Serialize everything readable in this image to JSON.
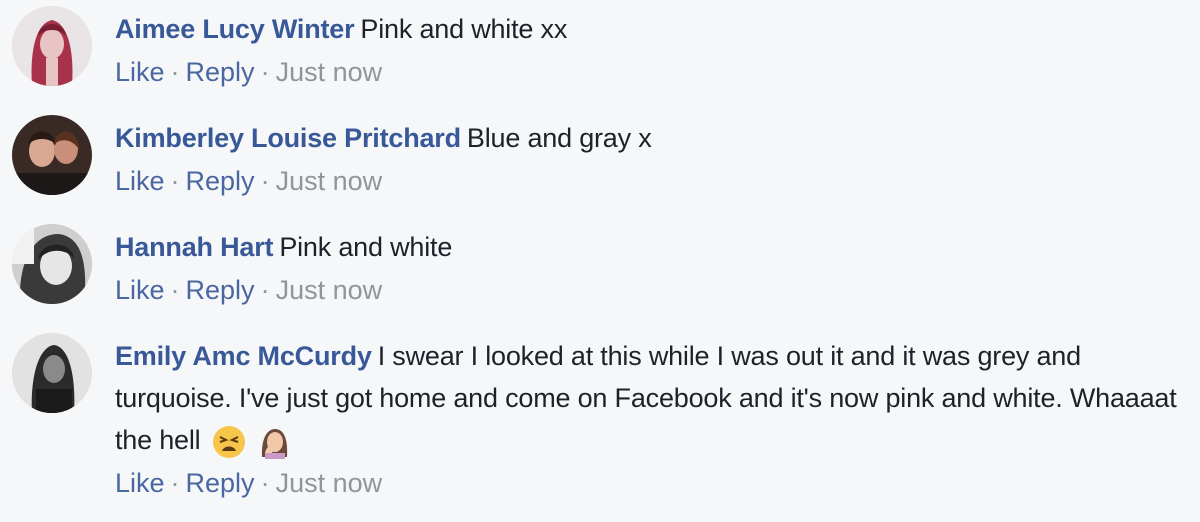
{
  "comments": [
    {
      "author": "Aimee Lucy Winter",
      "text": "Pink and white xx",
      "like": "Like",
      "reply": "Reply",
      "time": "Just now",
      "avatar_icon": "profile-photo-red-hair"
    },
    {
      "author": "Kimberley Louise Pritchard",
      "text": "Blue and gray x",
      "like": "Like",
      "reply": "Reply",
      "time": "Just now",
      "avatar_icon": "profile-photo-couple"
    },
    {
      "author": "Hannah Hart",
      "text": "Pink and white",
      "like": "Like",
      "reply": "Reply",
      "time": "Just now",
      "avatar_icon": "profile-photo-grayscale"
    },
    {
      "author": "Emily Amc McCurdy",
      "text": "I swear I looked at this while I was out it and it was grey and turquoise. I've just got home and come on Facebook and it's now pink and white. Whaaaat the hell",
      "like": "Like",
      "reply": "Reply",
      "time": "Just now",
      "avatar_icon": "profile-photo-dark",
      "emojis": [
        "tired-face-emoji",
        "woman-facepalming-emoji"
      ]
    }
  ],
  "colors": {
    "author": "#385898",
    "link": "#4b67a1",
    "meta": "#90949c",
    "text": "#1d2129",
    "background": "#f6f7f9"
  }
}
